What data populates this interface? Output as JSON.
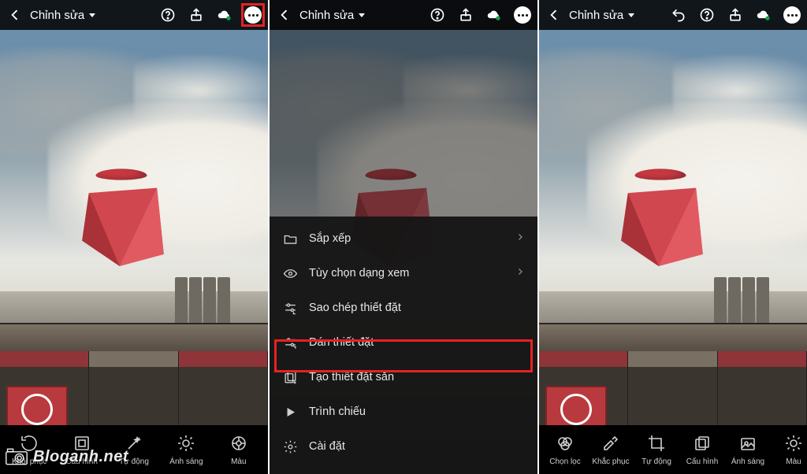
{
  "watermark": "Bloganh.net",
  "panel1": {
    "title": "Chỉnh sửa",
    "tools": [
      {
        "name": "restore",
        "label": "Khôi phục"
      },
      {
        "name": "frame",
        "label": "Cấu hình"
      },
      {
        "name": "auto",
        "label": "Tự động"
      },
      {
        "name": "light",
        "label": "Ánh sáng"
      },
      {
        "name": "color",
        "label": "Màu"
      }
    ]
  },
  "panel2": {
    "title": "Chỉnh sửa",
    "menu": [
      {
        "name": "organize",
        "label": "Sắp xếp",
        "chevron": true
      },
      {
        "name": "view-options",
        "label": "Tùy chọn dạng xem",
        "chevron": true
      },
      {
        "name": "copy-settings",
        "label": "Sao chép thiết đặt",
        "chevron": false
      },
      {
        "name": "paste-settings",
        "label": "Dán thiết đặt",
        "chevron": false
      },
      {
        "name": "create-preset",
        "label": "Tạo thiết đặt sẵn",
        "chevron": false
      },
      {
        "name": "slideshow",
        "label": "Trình chiếu",
        "chevron": false
      },
      {
        "name": "settings",
        "label": "Cài đặt",
        "chevron": false
      }
    ]
  },
  "panel3": {
    "title": "Chỉnh sửa",
    "tools": [
      {
        "name": "filter",
        "label": "Chọn lọc"
      },
      {
        "name": "restore",
        "label": "Khắc phục"
      },
      {
        "name": "crop",
        "label": "Tự động"
      },
      {
        "name": "copies",
        "label": "Cấu hình"
      },
      {
        "name": "presets",
        "label": "Ánh sáng"
      },
      {
        "name": "light",
        "label": "Màu"
      }
    ]
  }
}
